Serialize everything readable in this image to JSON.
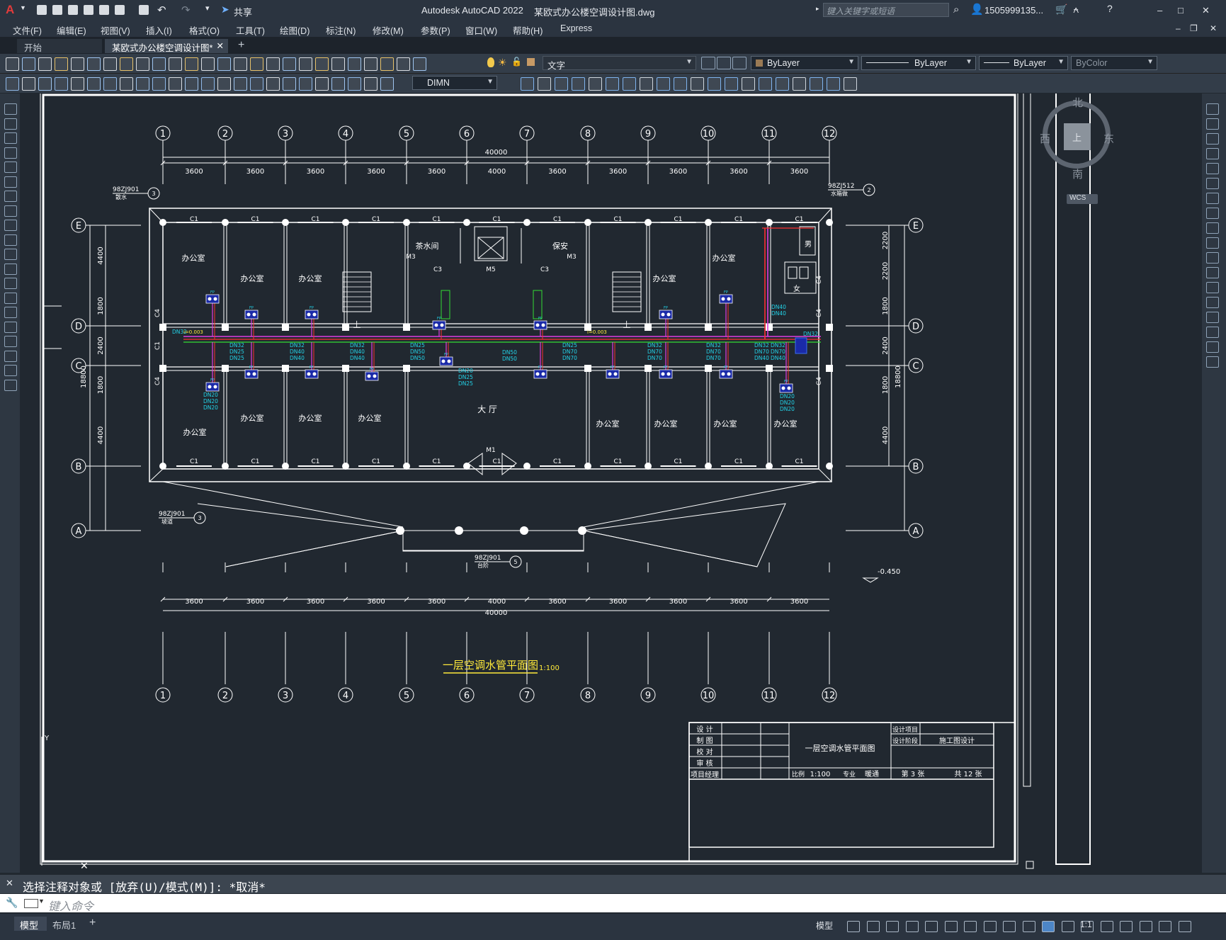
{
  "app": {
    "logo": "A",
    "title": "Autodesk AutoCAD 2022",
    "file": "某欧式办公楼空调设计图.dwg",
    "share": "共享",
    "search_placeholder": "键入关键字或短语",
    "user": "1505999135...",
    "win_controls": [
      "–",
      "□",
      "✕"
    ]
  },
  "menu": [
    "文件(F)",
    "编辑(E)",
    "视图(V)",
    "插入(I)",
    "格式(O)",
    "工具(T)",
    "绘图(D)",
    "标注(N)",
    "修改(M)",
    "参数(P)",
    "窗口(W)",
    "帮助(H)",
    "Express"
  ],
  "tabs": [
    "开始",
    "某欧式办公楼空调设计图*"
  ],
  "toolbar": {
    "layer_value": "文字",
    "color_value": "ByLayer",
    "linetype_value": "ByLayer",
    "lineweight_value": "ByLayer",
    "plotstyle_value": "ByColor",
    "dimstyle_value": "DIMN"
  },
  "viewcube": {
    "north": "北",
    "south": "南",
    "east": "东",
    "west": "西",
    "top": "上",
    "wcs": "WCS"
  },
  "drawing": {
    "axes_numbers": [
      "1",
      "2",
      "3",
      "4",
      "5",
      "6",
      "7",
      "8",
      "9",
      "10",
      "11",
      "12"
    ],
    "axes_letters": [
      "E",
      "D",
      "C",
      "B",
      "A"
    ],
    "bay_dim": "3600",
    "center_bay_dim": "4000",
    "total_width": "40000",
    "vert_dims_left": [
      "4400",
      "1800",
      "2400",
      "1800",
      "4400"
    ],
    "vert_total": "18800",
    "vert_dims_right": [
      "2200",
      "2200",
      "1800",
      "2400",
      "1800",
      "4400"
    ],
    "rooms": {
      "office": "办公室",
      "tea": "茶水间",
      "guard": "保安",
      "hall": "大 厅",
      "male": "男",
      "female": "女",
      "up": "上"
    },
    "window_label": "C1",
    "c3": "C3",
    "c4": "C4",
    "m1": "M1",
    "m3": "M3",
    "m5": "M5",
    "refs": {
      "r1": "98ZJ901",
      "r1_sub": "散水",
      "r2": "98ZJ512",
      "r2_sub": "水箱做",
      "r3": "98ZJ901",
      "r3_sub": "台阶",
      "r4": "98ZJ901",
      "r4_sub": "坡道"
    },
    "elevation": "-0.450",
    "pipes": [
      "DN32",
      "DN25",
      "DN40",
      "DN50",
      "DN70",
      "DN20"
    ],
    "pipe_note": "i=0.003",
    "drawing_title": "一层空调水管平面图",
    "drawing_scale": "1:100"
  },
  "titleblock": {
    "roles": [
      "设 计",
      "制 图",
      "校 对",
      "审 核",
      "项目经理"
    ],
    "name": "一层空调水管平面图",
    "proj_label": "设计项目",
    "stage_label": "设计阶段",
    "stage_value": "施工图设计",
    "scale_label": "比例",
    "scale_value": "1:100",
    "major_label": "专业",
    "major_value": "暖通",
    "sheet": "第 3 张",
    "total": "共 12 张"
  },
  "command": {
    "history": "选择注释对象或 [放弃(U)/模式(M)]: *取消*",
    "placeholder": "键入命令"
  },
  "status": {
    "tab_model": "模型",
    "tab_layout": "布局1",
    "model_btn": "模型",
    "scale": "1:1"
  }
}
